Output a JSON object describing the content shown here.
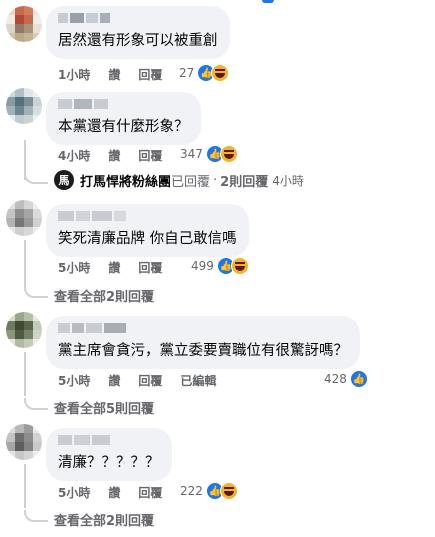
{
  "comments": [
    {
      "text": "居然還有形象可以被重創",
      "time": "1小時",
      "like": "讚",
      "reply": "回覆",
      "count": "27",
      "reactions": [
        "like",
        "haha"
      ]
    },
    {
      "text": "本黨還有什麼形象？",
      "time": "4小時",
      "like": "讚",
      "reply": "回覆",
      "count": "347",
      "reactions": [
        "like",
        "haha"
      ]
    },
    {
      "text": "笑死清廉品牌 你自己敢信嗎",
      "time": "5小時",
      "like": "讚",
      "reply": "回覆",
      "count": "499",
      "reactions": [
        "like",
        "haha"
      ]
    },
    {
      "text": "黨主席會貪污，黨立委要賣職位有很驚訝嗎？",
      "time": "5小時",
      "like": "讚",
      "reply": "回覆",
      "edited": "已編輯",
      "count": "428",
      "reactions": [
        "like"
      ]
    },
    {
      "text": "清廉？？？？？",
      "time": "5小時",
      "like": "讚",
      "reply": "回覆",
      "count": "222",
      "reactions": [
        "like",
        "haha"
      ]
    }
  ],
  "page_reply": {
    "avatar": "馬",
    "name": "打馬悍將粉絲團",
    "action": "已回覆",
    "sep": "·",
    "count": "2則回覆",
    "time": "4小時"
  },
  "view_replies": [
    "查看全部2則回覆",
    "查看全部5則回覆",
    "查看全部2則回覆"
  ],
  "colors": {
    "like": "#1877f2",
    "haha": "#f7b125",
    "bubble": "#f0f2f5",
    "meta": "#65676b"
  }
}
